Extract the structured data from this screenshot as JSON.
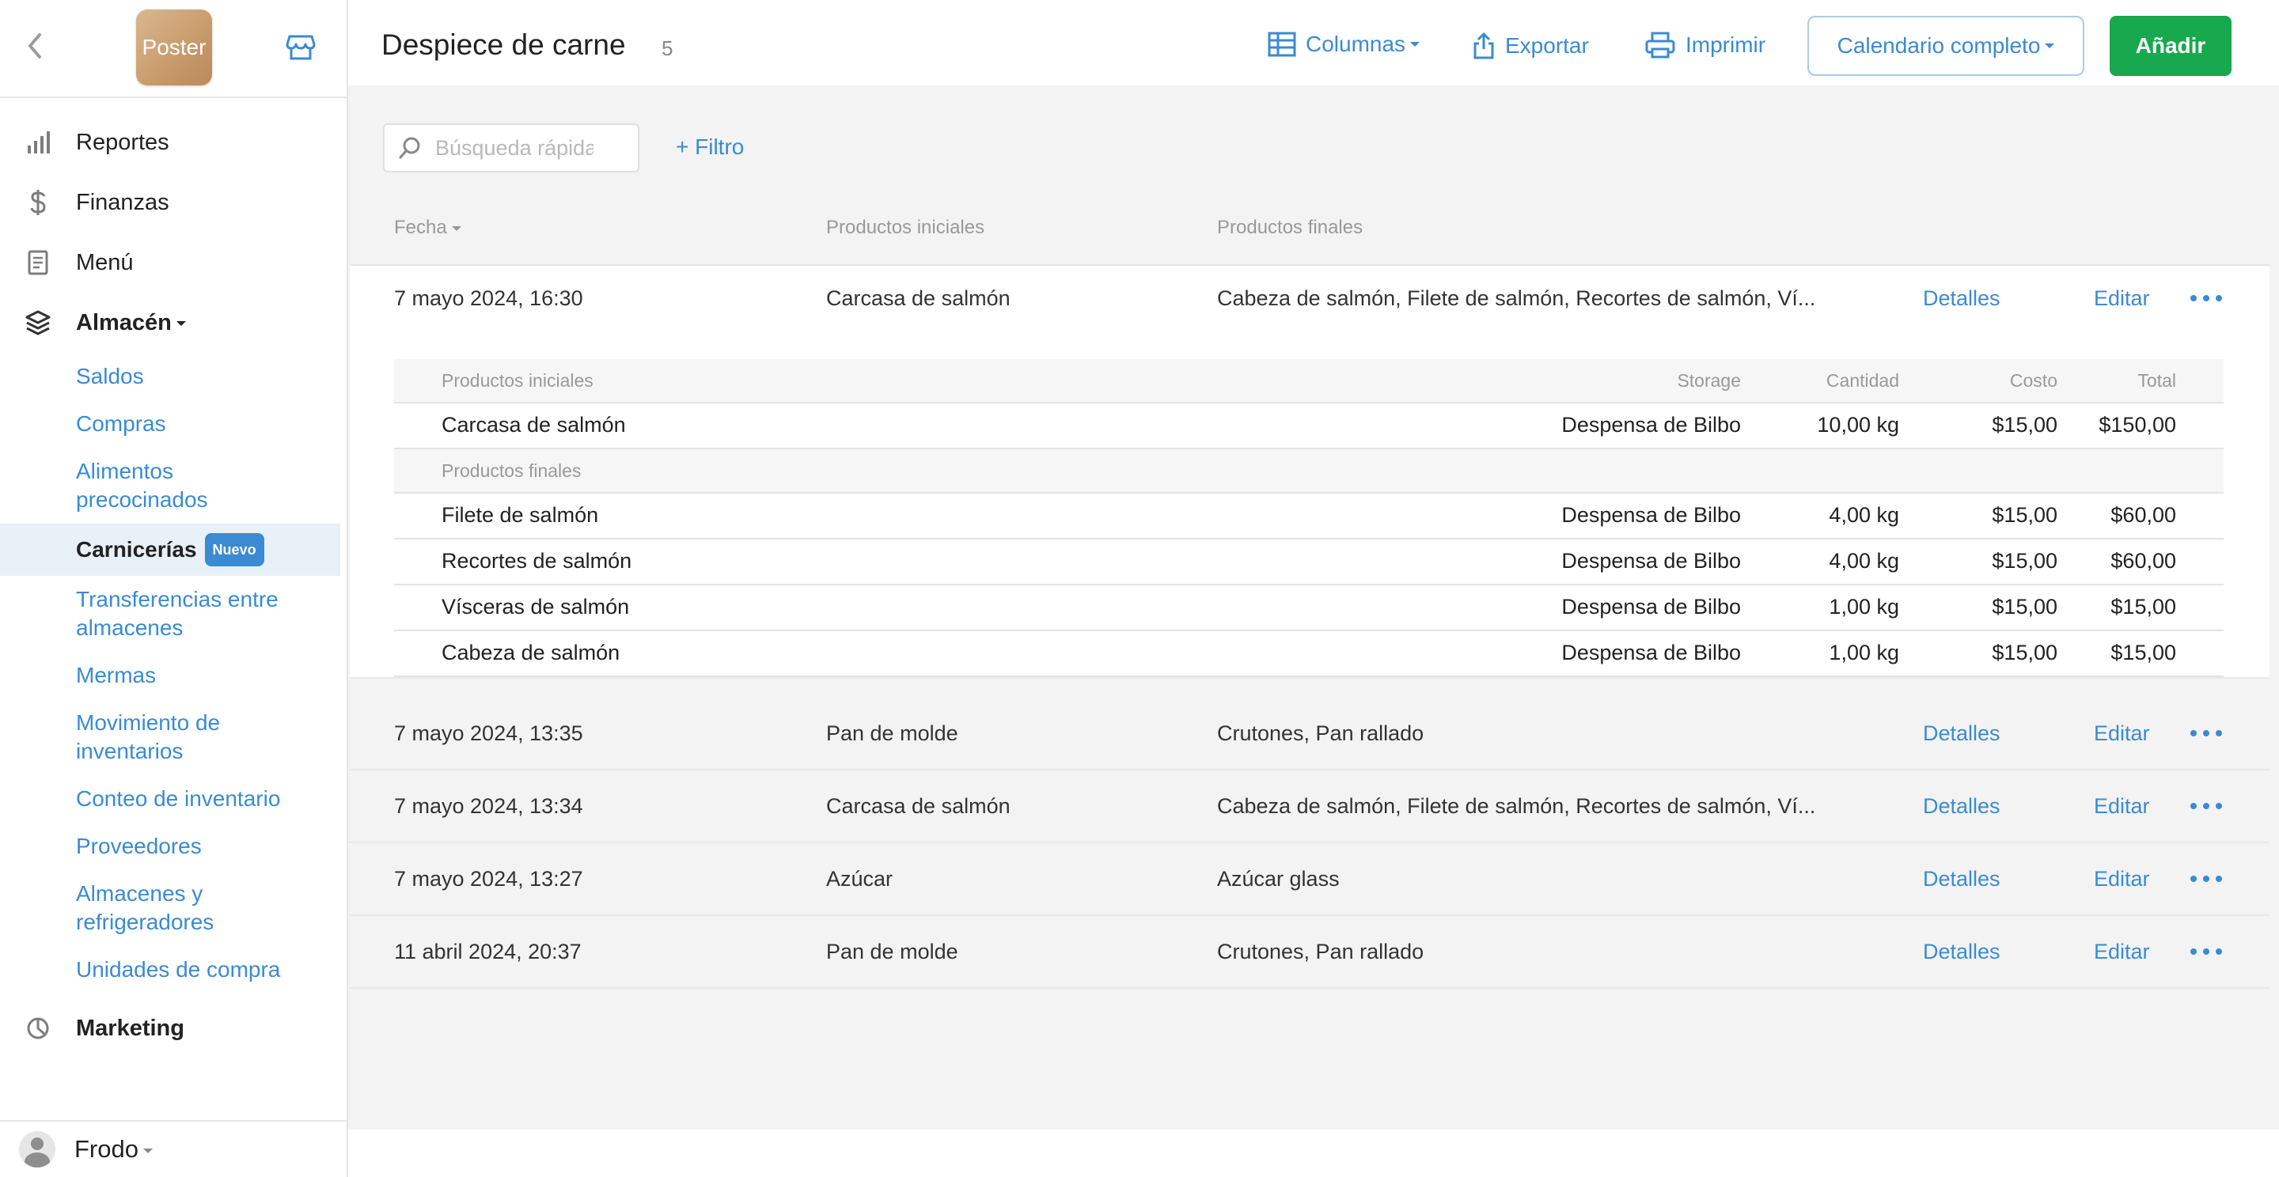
{
  "sidebar": {
    "logo_text": "Poster",
    "nav": [
      {
        "label": "Reportes",
        "icon": "bar-chart-icon"
      },
      {
        "label": "Finanzas",
        "icon": "dollar-icon"
      },
      {
        "label": "Menú",
        "icon": "document-icon"
      },
      {
        "label": "Almacén",
        "icon": "layers-icon"
      }
    ],
    "sub_items": [
      "Saldos",
      "Compras",
      "Alimentos precocinados",
      "Carnicerías",
      "Transferencias entre almacenes",
      "Mermas",
      "Movimiento de inventarios",
      "Conteo de inventario",
      "Proveedores",
      "Almacenes y refrigeradores",
      "Unidades de compra"
    ],
    "active_badge": "Nuevo",
    "marketing": "Marketing",
    "user": "Frodo"
  },
  "header": {
    "title": "Despiece de carne",
    "count": "5",
    "columns": "Columnas",
    "export": "Exportar",
    "print": "Imprimir",
    "calendar": "Calendario completo",
    "add": "Añadir"
  },
  "toolbar": {
    "search_placeholder": "Búsqueda rápida",
    "filter": "+ Filtro"
  },
  "table": {
    "headers": [
      "Fecha",
      "Productos iniciales",
      "Productos finales"
    ],
    "details_label": "Detalles",
    "edit_label": "Editar",
    "rows": [
      {
        "date": "7 mayo 2024, 16:30",
        "initial": "Carcasa de salmón",
        "final": "Cabeza de salmón, Filete de salmón, Recortes de salmón, Ví..."
      },
      {
        "date": "7 mayo 2024, 13:35",
        "initial": "Pan de molde",
        "final": "Crutones, Pan rallado"
      },
      {
        "date": "7 mayo 2024, 13:34",
        "initial": "Carcasa de salmón",
        "final": "Cabeza de salmón, Filete de salmón, Recortes de salmón, Ví..."
      },
      {
        "date": "7 mayo 2024, 13:27",
        "initial": "Azúcar",
        "final": "Azúcar glass"
      },
      {
        "date": "11 abril 2024, 20:37",
        "initial": "Pan de molde",
        "final": "Crutones, Pan rallado"
      }
    ]
  },
  "detail": {
    "headers": {
      "initial": "Productos iniciales",
      "storage": "Storage",
      "qty": "Cantidad",
      "cost": "Costo",
      "total": "Total"
    },
    "initial_items": [
      {
        "name": "Carcasa de salmón",
        "storage": "Despensa de Bilbo",
        "qty": "10,00 kg",
        "cost": "$15,00",
        "total": "$150,00"
      }
    ],
    "final_header": "Productos finales",
    "final_items": [
      {
        "name": "Filete de salmón",
        "storage": "Despensa de Bilbo",
        "qty": "4,00 kg",
        "cost": "$15,00",
        "total": "$60,00"
      },
      {
        "name": "Recortes de salmón",
        "storage": "Despensa de Bilbo",
        "qty": "4,00 kg",
        "cost": "$15,00",
        "total": "$60,00"
      },
      {
        "name": "Vísceras de salmón",
        "storage": "Despensa de Bilbo",
        "qty": "1,00 kg",
        "cost": "$15,00",
        "total": "$15,00"
      },
      {
        "name": "Cabeza de salmón",
        "storage": "Despensa de Bilbo",
        "qty": "1,00 kg",
        "cost": "$15,00",
        "total": "$15,00"
      }
    ]
  }
}
